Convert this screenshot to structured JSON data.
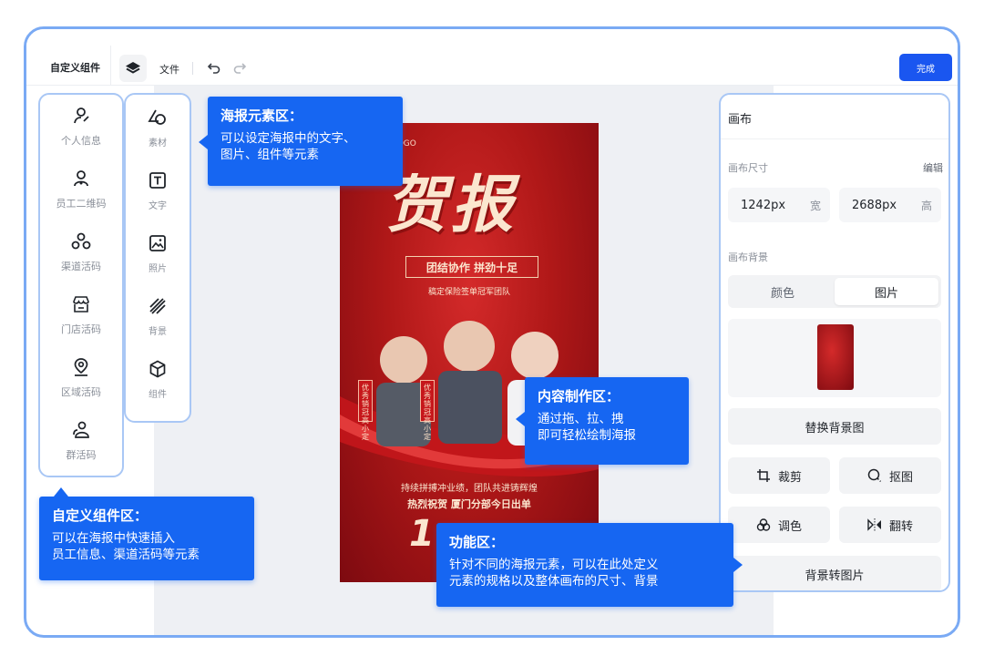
{
  "topbar": {
    "app_title": "自定义组件",
    "file_label": "文件",
    "done_label": "完成",
    "icons": [
      "layers-icon",
      "undo-icon",
      "redo-icon"
    ]
  },
  "components_panel": {
    "items": [
      {
        "label": "个人信息",
        "icon": "person-icon"
      },
      {
        "label": "员工二维码",
        "icon": "employee-icon"
      },
      {
        "label": "渠道活码",
        "icon": "channel-icon"
      },
      {
        "label": "门店活码",
        "icon": "store-icon"
      },
      {
        "label": "区域活码",
        "icon": "location-pin-icon"
      },
      {
        "label": "群活码",
        "icon": "group-icon"
      }
    ]
  },
  "materials_panel": {
    "items": [
      {
        "label": "素材",
        "icon": "shapes-icon"
      },
      {
        "label": "文字",
        "icon": "text-icon"
      },
      {
        "label": "照片",
        "icon": "image-icon"
      },
      {
        "label": "背景",
        "icon": "background-icon"
      },
      {
        "label": "组件",
        "icon": "cube-icon"
      }
    ]
  },
  "poster": {
    "logo": "LOGO",
    "title": "贺报",
    "slogan": "团结协作 拼劲十足",
    "subtitle": "稿定保险签单冠军团队",
    "tag_1": "优秀销冠",
    "tag_1_name": "高小定",
    "tag_2": "优秀销冠",
    "tag_2_name": "高小定",
    "bottom_line_1": "持续拼搏冲业绩，团队共进铸辉煌",
    "bottom_line_2": "热烈祝贺 厦门分部今日出单",
    "big_number": "1",
    "colors": {
      "primary": "#b01818",
      "text": "#fbe6cf"
    }
  },
  "right_panel": {
    "title": "画布",
    "size_label": "画布尺寸",
    "edit_label": "编辑",
    "width_value": "1242px",
    "width_unit": "宽",
    "height_value": "2688px",
    "height_unit": "高",
    "bg_label": "画布背景",
    "tabs": [
      {
        "label": "颜色",
        "active": false
      },
      {
        "label": "图片",
        "active": true
      }
    ],
    "replace_bg": "替换背景图",
    "crop": "裁剪",
    "cutout": "抠图",
    "adjust": "调色",
    "flip": "翻转",
    "bg_to_image": "背景转图片"
  },
  "callouts": {
    "elements": {
      "title": "海报元素区：",
      "desc_1": "可以设定海报中的文字、",
      "desc_2": "图片、组件等元素"
    },
    "content": {
      "title": "内容制作区：",
      "desc_1": "通过拖、拉、拽",
      "desc_2": "即可轻松绘制海报"
    },
    "components": {
      "title": "自定义组件区：",
      "desc_1": "可以在海报中快速插入",
      "desc_2": "员工信息、渠道活码等元素"
    },
    "functions": {
      "title": "功能区：",
      "desc_1": "针对不同的海报元素，可以在此处定义",
      "desc_2": "元素的规格以及整体画布的尺寸、背景"
    }
  },
  "theme": {
    "accent": "#1666f2",
    "button": "#1a56f0",
    "panel_border": "#a9c7f5"
  }
}
